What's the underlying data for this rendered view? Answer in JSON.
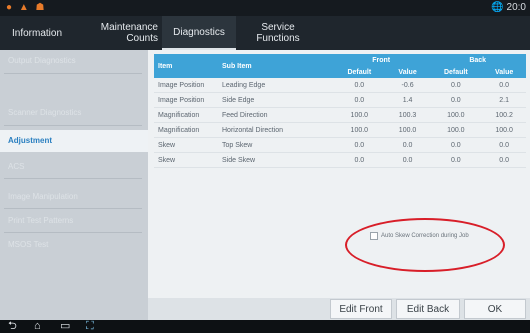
{
  "status": {
    "icons": "● ▲ ☗",
    "time": "🌐 20:0"
  },
  "tabs": [
    {
      "label": "Information"
    },
    {
      "label": "Maintenance\nCounts"
    },
    {
      "label": "Diagnostics"
    },
    {
      "label": "Service\nFunctions"
    }
  ],
  "sidebar": {
    "items": [
      {
        "label": "Output Diagnostics"
      },
      {
        "label": "Scanner Diagnostics"
      },
      {
        "label": "Adjustment"
      },
      {
        "label": "ACS"
      },
      {
        "label": "Image Manipulation"
      },
      {
        "label": "Print Test Patterns"
      },
      {
        "label": "MSOS Test"
      }
    ]
  },
  "table": {
    "headers": {
      "item": "Item",
      "sub_item": "Sub Item",
      "front": "Front",
      "back": "Back",
      "default": "Default",
      "value": "Value"
    },
    "rows": [
      {
        "item": "Image Position",
        "sub": "Leading Edge",
        "f_def": "0.0",
        "f_val": "-0.6",
        "b_def": "0.0",
        "b_val": "0.0"
      },
      {
        "item": "Image Position",
        "sub": "Side Edge",
        "f_def": "0.0",
        "f_val": "1.4",
        "b_def": "0.0",
        "b_val": "2.1"
      },
      {
        "item": "Magnification",
        "sub": "Feed Direction",
        "f_def": "100.0",
        "f_val": "100.3",
        "b_def": "100.0",
        "b_val": "100.2"
      },
      {
        "item": "Magnification",
        "sub": "Horizontal Direction",
        "f_def": "100.0",
        "f_val": "100.0",
        "b_def": "100.0",
        "b_val": "100.0"
      },
      {
        "item": "Skew",
        "sub": "Top Skew",
        "f_def": "0.0",
        "f_val": "0.0",
        "b_def": "0.0",
        "b_val": "0.0"
      },
      {
        "item": "Skew",
        "sub": "Side Skew",
        "f_def": "0.0",
        "f_val": "0.0",
        "b_def": "0.0",
        "b_val": "0.0"
      }
    ]
  },
  "checkbox": {
    "label": "Auto Skew Correction during Job",
    "checked": false
  },
  "buttons": {
    "edit_front": "Edit Front",
    "edit_back": "Edit Back",
    "ok": "OK"
  },
  "nav": {
    "back": "⮌",
    "home": "⌂",
    "recent": "▭",
    "screenshot": "⛶"
  }
}
